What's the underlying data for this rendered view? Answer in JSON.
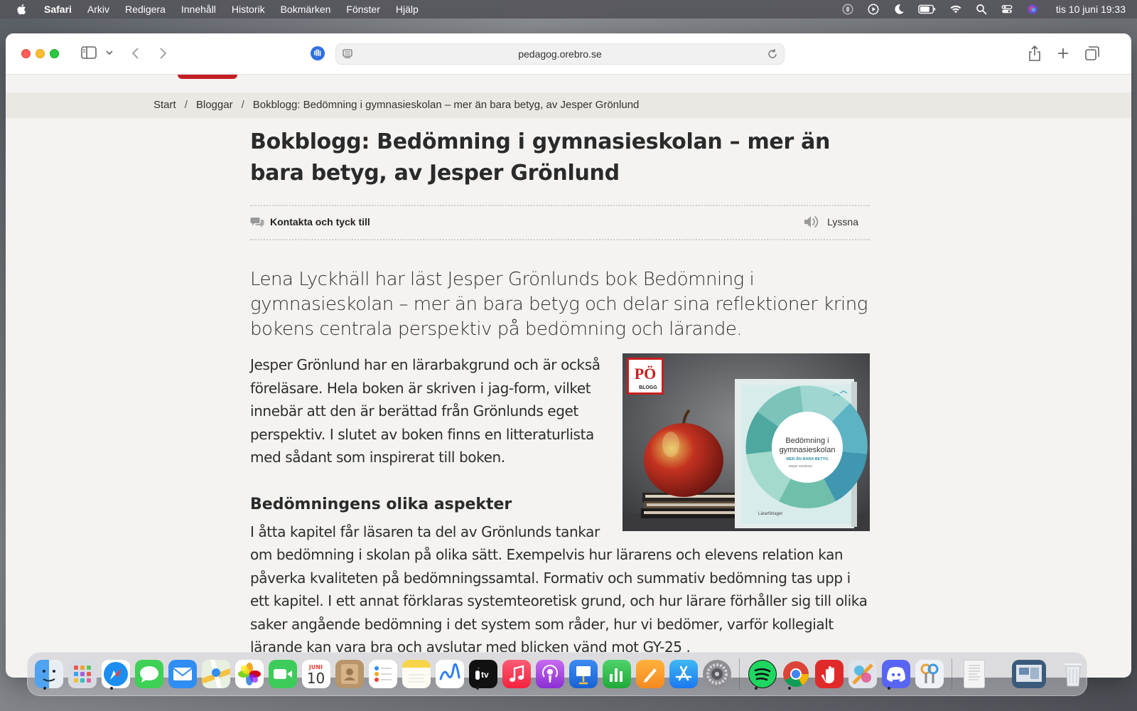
{
  "menubar": {
    "app_name": "Safari",
    "menus": [
      "Arkiv",
      "Redigera",
      "Innehåll",
      "Historik",
      "Bokmärken",
      "Fönster",
      "Hjälp"
    ],
    "clock": "tis 10 juni 19:33",
    "status_icons": [
      "privacy-icon",
      "play-icon",
      "moon-icon",
      "battery-icon",
      "wifi-icon",
      "spotlight-icon",
      "control-center-icon",
      "siri-icon"
    ]
  },
  "browser": {
    "url": "pedagog.orebro.se",
    "toolbar_icons": [
      "sidebar-icon",
      "chevron-down-icon",
      "back-icon",
      "forward-icon",
      "privacy-shield-icon",
      "reader-icon",
      "reload-icon",
      "share-icon",
      "new-tab-icon",
      "tab-overview-icon"
    ]
  },
  "breadcrumb": {
    "items": [
      "Start",
      "Bloggar",
      "Bokblogg: Bedömning i gymnasieskolan – mer än bara betyg, av Jesper Grönlund"
    ],
    "separator": "/"
  },
  "article": {
    "title": "Bokblogg: Bedömning i gymnasieskolan – mer än bara betyg, av Jesper Grönlund",
    "contact_label": "Kontakta och tyck till",
    "listen_label": "Lyssna",
    "ingress": "Lena Lyckhäll har läst Jesper Grönlunds bok Bedömning i gymnasieskolan – mer än bara betyg och delar sina reflektioner kring bokens centrala perspektiv på bedömning och lärande.",
    "paragraph1": "Jesper Grönlund har en lärarbakgrund och är också föreläsare. Hela boken är skriven i jag-form, vilket innebär att den är berättad från Grönlunds eget perspektiv. I slutet av boken finns en litteraturlista med sådant som inspirerat till boken.",
    "subheading": "Bedömningens olika aspekter",
    "paragraph2": "I åtta kapitel får läsaren ta del av Grönlunds tankar om bedömning i skolan på olika sätt. Exempelvis hur lärarens och elevens relation kan påverka kvaliteten på bedömningssamtal. Formativ och summativ bedömning tas upp i ett kapitel. I ett annat förklaras systemteoretisk grund, och hur lärare förhåller sig till olika saker angående bedömning i det system som råder, hur vi bedömer, varför kollegialt lärande kan vara bra och avslutar med blicken vänd mot GY-25 .",
    "image": {
      "badge_top": "PÖ",
      "badge_bottom": "BLOGG",
      "book_title_line1": "Bedömning i",
      "book_title_line2": "gymnasieskolan",
      "book_subtitle": "MER ÄN BARA BETYG",
      "book_author": "Jesper Grönlund",
      "book_publisher": "Lärarförlaget"
    }
  },
  "dock": {
    "calendar_month": "JUNI",
    "calendar_day": "10",
    "apps": [
      "finder-icon",
      "launchpad-icon",
      "safari-icon",
      "messages-icon",
      "mail-icon",
      "maps-icon",
      "photos-icon",
      "facetime-icon",
      "calendar-icon",
      "contacts-icon",
      "reminders-icon",
      "notes-icon",
      "freeform-icon",
      "tv-icon",
      "music-icon",
      "podcasts-icon",
      "keynote-icon",
      "numbers-icon",
      "pages-icon",
      "app-store-icon",
      "settings-icon",
      "spotify-icon",
      "chrome-icon",
      "adblock-icon",
      "colorsync-icon",
      "discord-icon",
      "keychain-icon",
      "document-icon",
      "downloads-icon",
      "trash-icon"
    ]
  }
}
